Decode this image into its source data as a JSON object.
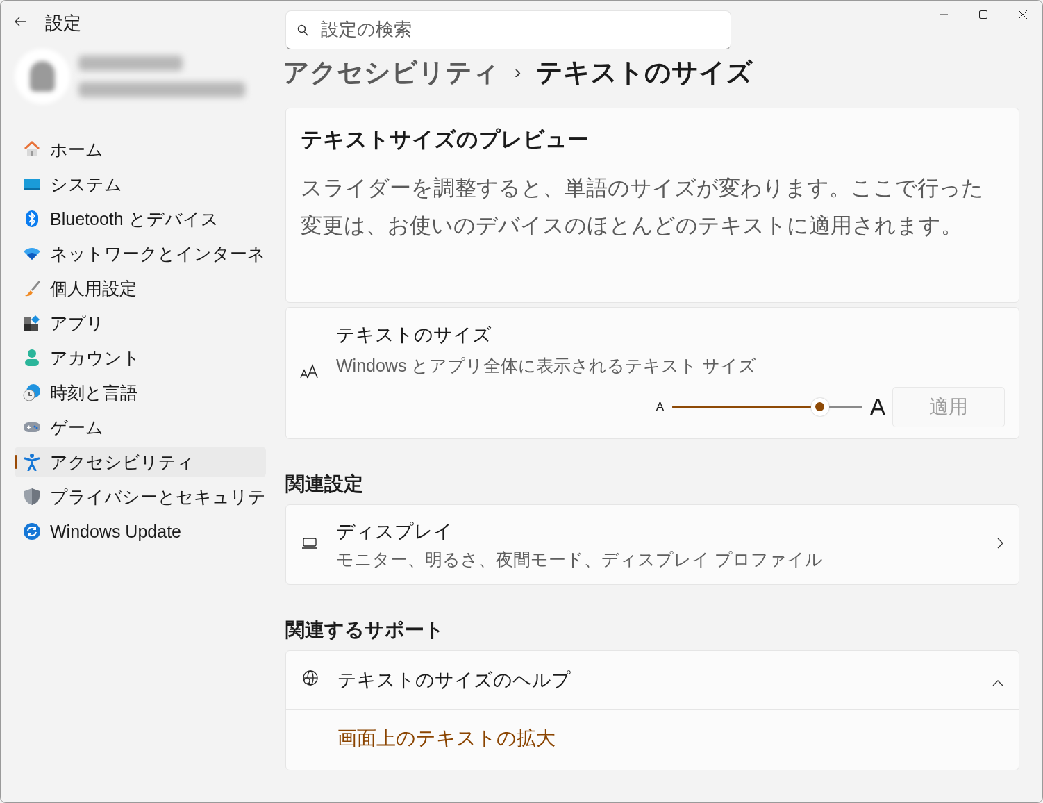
{
  "window": {
    "title": "設定"
  },
  "search": {
    "placeholder": "設定の検索"
  },
  "sidebar": {
    "items": [
      {
        "label": "ホーム",
        "kind": "home",
        "selected": false
      },
      {
        "label": "システム",
        "kind": "system",
        "selected": false
      },
      {
        "label": "Bluetooth とデバイス",
        "kind": "bluetooth",
        "selected": false
      },
      {
        "label": "ネットワークとインターネ",
        "kind": "network",
        "selected": false
      },
      {
        "label": "個人用設定",
        "kind": "brush",
        "selected": false
      },
      {
        "label": "アプリ",
        "kind": "apps",
        "selected": false
      },
      {
        "label": "アカウント",
        "kind": "account",
        "selected": false
      },
      {
        "label": "時刻と言語",
        "kind": "time",
        "selected": false
      },
      {
        "label": "ゲーム",
        "kind": "game",
        "selected": false
      },
      {
        "label": "アクセシビリティ",
        "kind": "access",
        "selected": true
      },
      {
        "label": "プライバシーとセキュリテ",
        "kind": "shield",
        "selected": false
      },
      {
        "label": "Windows Update",
        "kind": "update",
        "selected": false
      }
    ]
  },
  "breadcrumb": {
    "parent": "アクセシビリティ",
    "separator": "›",
    "current": "テキストのサイズ"
  },
  "preview": {
    "title": "テキストサイズのプレビュー",
    "text": "スライダーを調整すると、単語のサイズが変わります。ここで行った変更は、お使いのデバイスのほとんどのテキストに適用されます。"
  },
  "text_size": {
    "title": "テキストのサイズ",
    "description": "Windows とアプリ全体に表示されるテキスト サイズ",
    "small_label": "A",
    "large_label": "A",
    "level": 0.78,
    "apply_button": {
      "label": "適用",
      "disabled": true
    }
  },
  "related_settings": {
    "heading": "関連設定",
    "items": [
      {
        "title": "ディスプレイ",
        "description": "モニター、明るさ、夜間モード、ディスプレイ プロファイル"
      }
    ]
  },
  "related_support": {
    "heading": "関連するサポート",
    "help": {
      "title": "テキストのサイズのヘルプ",
      "expanded": true,
      "links": [
        "画面上のテキストの拡大"
      ]
    }
  }
}
